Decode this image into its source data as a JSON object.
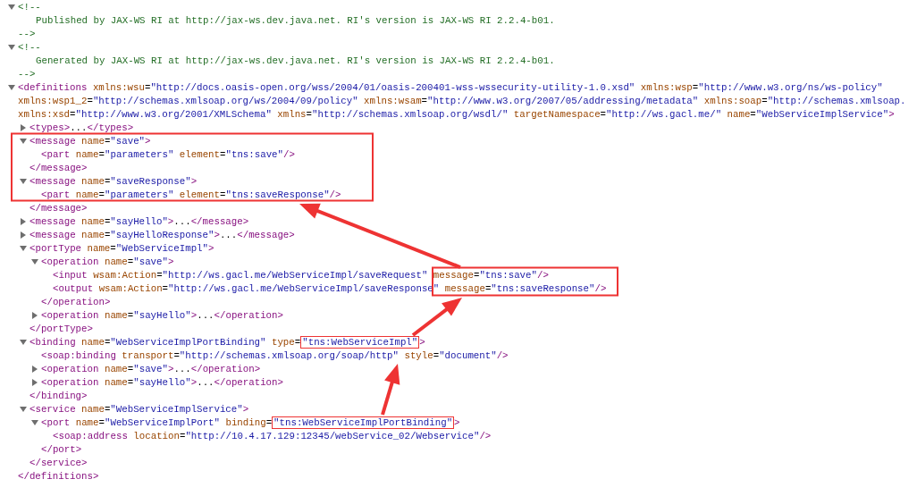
{
  "nodes": [
    {
      "kind": "comment",
      "expanded": true,
      "open": "<!--",
      "body": "Published by JAX-WS RI at http://jax-ws.dev.java.net. RI's version is JAX-WS RI 2.2.4-b01.",
      "close": "-->"
    },
    {
      "kind": "comment",
      "expanded": true,
      "open": "<!--",
      "body": "Generated by JAX-WS RI at http://jax-ws.dev.java.net. RI's version is JAX-WS RI 2.2.4-b01.",
      "close": "-->"
    },
    {
      "kind": "element",
      "expanded": true,
      "open_lines": [
        "<definitions xmlns:wsu=\"http://docs.oasis-open.org/wss/2004/01/oasis-200401-wss-wssecurity-utility-1.0.xsd\" xmlns:wsp=\"http://www.w3.org/ns/ws-policy\"",
        "xmlns:wsp1_2=\"http://schemas.xmlsoap.org/ws/2004/09/policy\" xmlns:wsam=\"http://www.w3.org/2007/05/addressing/metadata\" xmlns:soap=\"http://schemas.xmlsoap.",
        "xmlns:xsd=\"http://www.w3.org/2001/XMLSchema\" xmlns=\"http://schemas.xmlsoap.org/wsdl/\" targetNamespace=\"http://ws.gacl.me/\" name=\"WebServiceImplService\">"
      ],
      "close": "</definitions>",
      "children": [
        {
          "kind": "element",
          "expanded": false,
          "open_lines": [
            "<types>...</types>"
          ]
        },
        {
          "kind": "element",
          "expanded": true,
          "open_lines": [
            "<message name=\"save\">"
          ],
          "close": "</message>",
          "children": [
            {
              "kind": "leaf",
              "text": "<part name=\"parameters\" element=\"tns:save\"/>"
            }
          ]
        },
        {
          "kind": "element",
          "expanded": true,
          "open_lines": [
            "<message name=\"saveResponse\">"
          ],
          "close": "</message>",
          "children": [
            {
              "kind": "leaf",
              "text": "<part name=\"parameters\" element=\"tns:saveResponse\"/>"
            }
          ]
        },
        {
          "kind": "element",
          "expanded": false,
          "open_lines": [
            "<message name=\"sayHello\">...</message>"
          ]
        },
        {
          "kind": "element",
          "expanded": false,
          "open_lines": [
            "<message name=\"sayHelloResponse\">...</message>"
          ]
        },
        {
          "kind": "element",
          "expanded": true,
          "open_lines": [
            "<portType name=\"WebServiceImpl\">"
          ],
          "close": "</portType>",
          "children": [
            {
              "kind": "element",
              "expanded": true,
              "open_lines": [
                "<operation name=\"save\">"
              ],
              "close": "</operation>",
              "children": [
                {
                  "kind": "leaf",
                  "text": "<input wsam:Action=\"http://ws.gacl.me/WebServiceImpl/saveRequest\" message=\"tns:save\"/>"
                },
                {
                  "kind": "leaf",
                  "text": "<output wsam:Action=\"http://ws.gacl.me/WebServiceImpl/saveResponse\" message=\"tns:saveResponse\"/>"
                }
              ]
            },
            {
              "kind": "element",
              "expanded": false,
              "open_lines": [
                "<operation name=\"sayHello\">...</operation>"
              ]
            }
          ]
        },
        {
          "kind": "element",
          "expanded": true,
          "open_lines": [
            {
              "segments": [
                {
                  "text": "<binding name=\"WebServiceImplPortBinding\" type=",
                  "highlighted": false
                },
                {
                  "text": "\"tns:WebServiceImpl\"",
                  "highlighted": true
                },
                {
                  "text": ">",
                  "highlighted": false
                }
              ]
            }
          ],
          "close": "</binding>",
          "children": [
            {
              "kind": "leaf",
              "text": "<soap:binding transport=\"http://schemas.xmlsoap.org/soap/http\" style=\"document\"/>"
            },
            {
              "kind": "element",
              "expanded": false,
              "open_lines": [
                "<operation name=\"save\">...</operation>"
              ]
            },
            {
              "kind": "element",
              "expanded": false,
              "open_lines": [
                "<operation name=\"sayHello\">...</operation>"
              ]
            }
          ]
        },
        {
          "kind": "element",
          "expanded": true,
          "open_lines": [
            "<service name=\"WebServiceImplService\">"
          ],
          "close": "</service>",
          "children": [
            {
              "kind": "element",
              "expanded": true,
              "open_lines": [
                {
                  "segments": [
                    {
                      "text": "<port name=\"WebServiceImplPort\" binding=",
                      "highlighted": false
                    },
                    {
                      "text": "\"tns:WebServiceImplPortBinding\"",
                      "highlighted": true
                    },
                    {
                      "text": ">",
                      "highlighted": false
                    }
                  ]
                }
              ],
              "close": "</port>",
              "children": [
                {
                  "kind": "leaf",
                  "text": "<soap:address location=\"http://10.4.17.129:12345/webService_02/Webservice\"/>"
                }
              ]
            }
          ]
        }
      ]
    }
  ]
}
